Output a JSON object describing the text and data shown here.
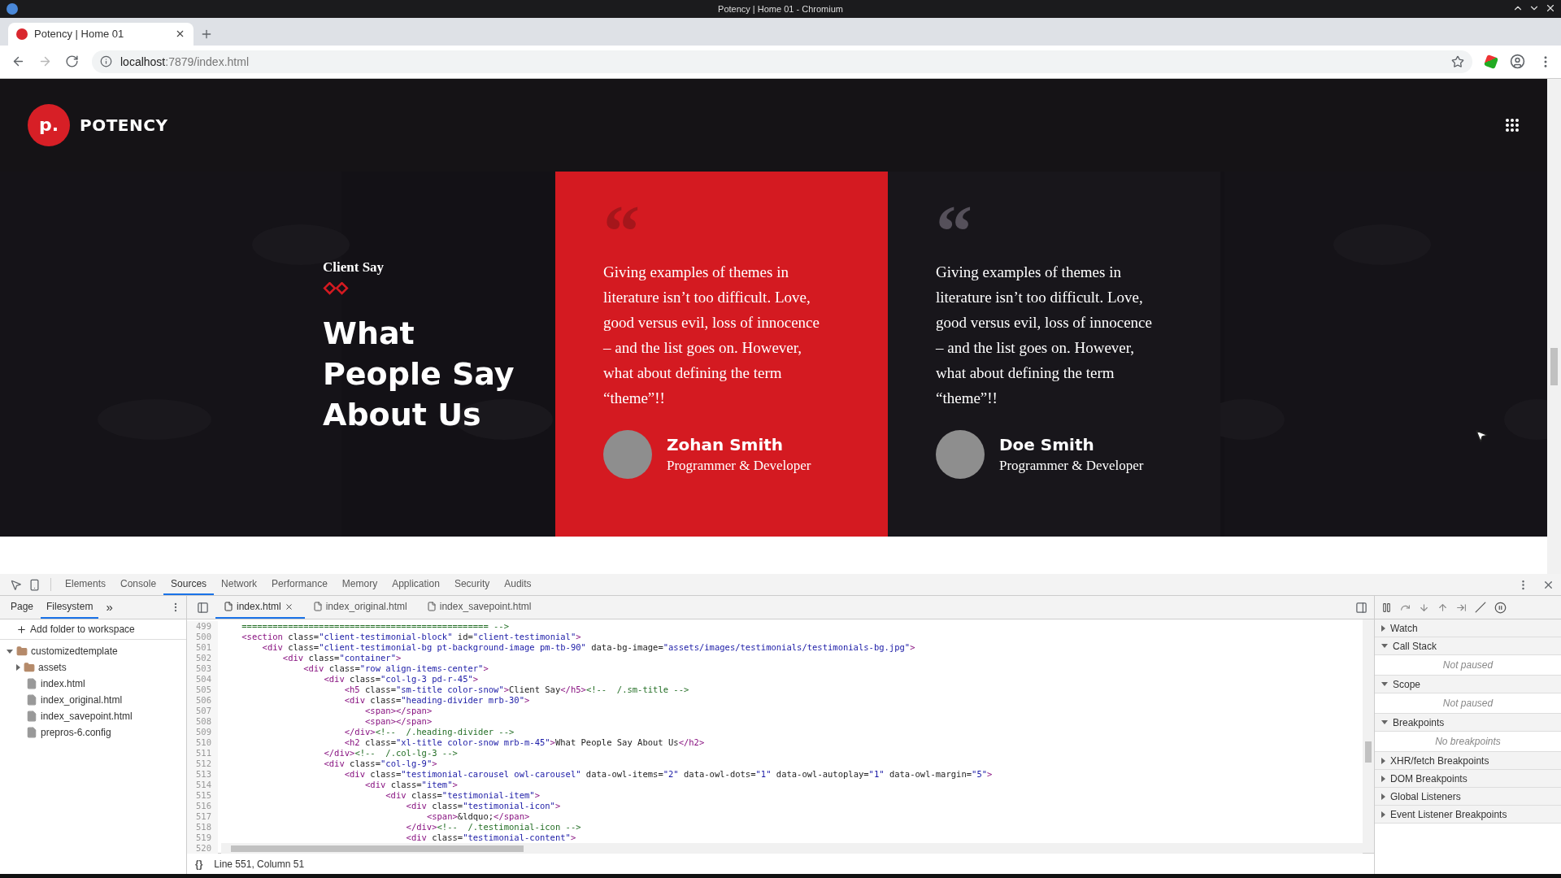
{
  "os_window": {
    "title": "Potency | Home 01 - Chromium"
  },
  "browser": {
    "tabs": [
      {
        "title": "Potency | Home 01",
        "selected": true
      }
    ],
    "nav": [
      {
        "kind": "back",
        "disabled": false
      },
      {
        "kind": "forward",
        "disabled": true
      },
      {
        "kind": "reload",
        "disabled": false
      }
    ],
    "url_host": "localhost",
    "url_rest": ":7879/index.html"
  },
  "site": {
    "logo_mark": "p.",
    "logo_text": "POTENCY",
    "section": {
      "eyebrow": "Client Say",
      "title": "What People Say About Us",
      "testimonials": [
        {
          "quote_mark": "“",
          "text": "Giving examples of themes in literature isn’t too difficult. Love, good versus evil, loss of innocence – and the list goes on. However, what about defining the term “theme”!!",
          "name": "Zohan Smith",
          "role": "Programmer & Developer",
          "selected": true
        },
        {
          "quote_mark": "“",
          "text": "Giving examples of themes in literature isn’t too difficult. Love, good versus evil, loss of innocence – and the list goes on. However, what about defining the term “theme”!!",
          "name": "Doe Smith",
          "role": "Programmer & Developer",
          "selected": false
        }
      ]
    }
  },
  "devtools": {
    "tabs": [
      {
        "label": "Elements",
        "selected": false
      },
      {
        "label": "Console",
        "selected": false
      },
      {
        "label": "Sources",
        "selected": true
      },
      {
        "label": "Network",
        "selected": false
      },
      {
        "label": "Performance",
        "selected": false
      },
      {
        "label": "Memory",
        "selected": false
      },
      {
        "label": "Application",
        "selected": false
      },
      {
        "label": "Security",
        "selected": false
      },
      {
        "label": "Audits",
        "selected": false
      }
    ],
    "navigator_tabs": [
      {
        "label": "Page",
        "selected": false
      },
      {
        "label": "Filesystem",
        "selected": true
      }
    ],
    "more": "»",
    "add_folder": "Add folder to workspace",
    "tree": [
      {
        "label": "customizedtemplate",
        "kind": "folder",
        "expanded": true,
        "children": [
          {
            "label": "assets",
            "kind": "folder",
            "expanded": false
          },
          {
            "label": "index.html",
            "kind": "file"
          },
          {
            "label": "index_original.html",
            "kind": "file"
          },
          {
            "label": "index_savepoint.html",
            "kind": "file"
          },
          {
            "label": "prepros-6.config",
            "kind": "file"
          }
        ]
      }
    ],
    "editor_tabs": [
      {
        "label": "index.html",
        "selected": true,
        "closable": true
      },
      {
        "label": "index_original.html",
        "selected": false,
        "closable": false
      },
      {
        "label": "index_savepoint.html",
        "selected": false,
        "closable": false
      }
    ],
    "lines": [
      {
        "number": "499",
        "code": "    ================================================ -->"
      },
      {
        "number": "500",
        "code": "    <section class=\"client-testimonial-block\" id=\"client-testimonial\">"
      },
      {
        "number": "501",
        "code": "        <div class=\"client-testimonial-bg pt-background-image pm-tb-90\" data-bg-image=\"assets/images/testimonials/testimonials-bg.jpg\">"
      },
      {
        "number": "502",
        "code": "            <div class=\"container\">"
      },
      {
        "number": "503",
        "code": "                <div class=\"row align-items-center\">"
      },
      {
        "number": "504",
        "code": "                    <div class=\"col-lg-3 pd-r-45\">"
      },
      {
        "number": "505",
        "code": "                        <h5 class=\"sm-title color-snow\">Client Say</h5><!--  /.sm-title -->"
      },
      {
        "number": "506",
        "code": "                        <div class=\"heading-divider mrb-30\">"
      },
      {
        "number": "507",
        "code": "                            <span></span>"
      },
      {
        "number": "508",
        "code": "                            <span></span>"
      },
      {
        "number": "509",
        "code": "                        </div><!--  /.heading-divider -->"
      },
      {
        "number": "510",
        "code": "                        <h2 class=\"xl-title color-snow mrb-m-45\">What People Say About Us</h2>"
      },
      {
        "number": "511",
        "code": "                    </div><!--  /.col-lg-3 -->"
      },
      {
        "number": "512",
        "code": "                    <div class=\"col-lg-9\">"
      },
      {
        "number": "513",
        "code": "                        <div class=\"testimonial-carousel owl-carousel\" data-owl-items=\"2\" data-owl-dots=\"1\" data-owl-autoplay=\"1\" data-owl-margin=\"5\">"
      },
      {
        "number": "514",
        "code": "                            <div class=\"item\">"
      },
      {
        "number": "515",
        "code": "                                <div class=\"testimonial-item\">"
      },
      {
        "number": "516",
        "code": "                                    <div class=\"testimonial-icon\">"
      },
      {
        "number": "517",
        "code": "                                        <span>&ldquo;</span>"
      },
      {
        "number": "518",
        "code": "                                    </div><!--  /.testimonial-icon -->"
      },
      {
        "number": "519",
        "code": "                                    <div class=\"testimonial-content\">"
      }
    ],
    "hidden_line_number": "520",
    "status": "Line 551, Column 51",
    "format_button": "{}",
    "debug_sections": [
      {
        "label": "Watch",
        "expanded": false
      },
      {
        "label": "Call Stack",
        "expanded": true,
        "note": "Not paused"
      },
      {
        "label": "Scope",
        "expanded": true,
        "note": "Not paused"
      },
      {
        "label": "Breakpoints",
        "expanded": true,
        "note": "No breakpoints"
      },
      {
        "label": "XHR/fetch Breakpoints",
        "expanded": false
      },
      {
        "label": "DOM Breakpoints",
        "expanded": false
      },
      {
        "label": "Global Listeners",
        "expanded": false
      },
      {
        "label": "Event Listener Breakpoints",
        "expanded": false
      }
    ]
  }
}
